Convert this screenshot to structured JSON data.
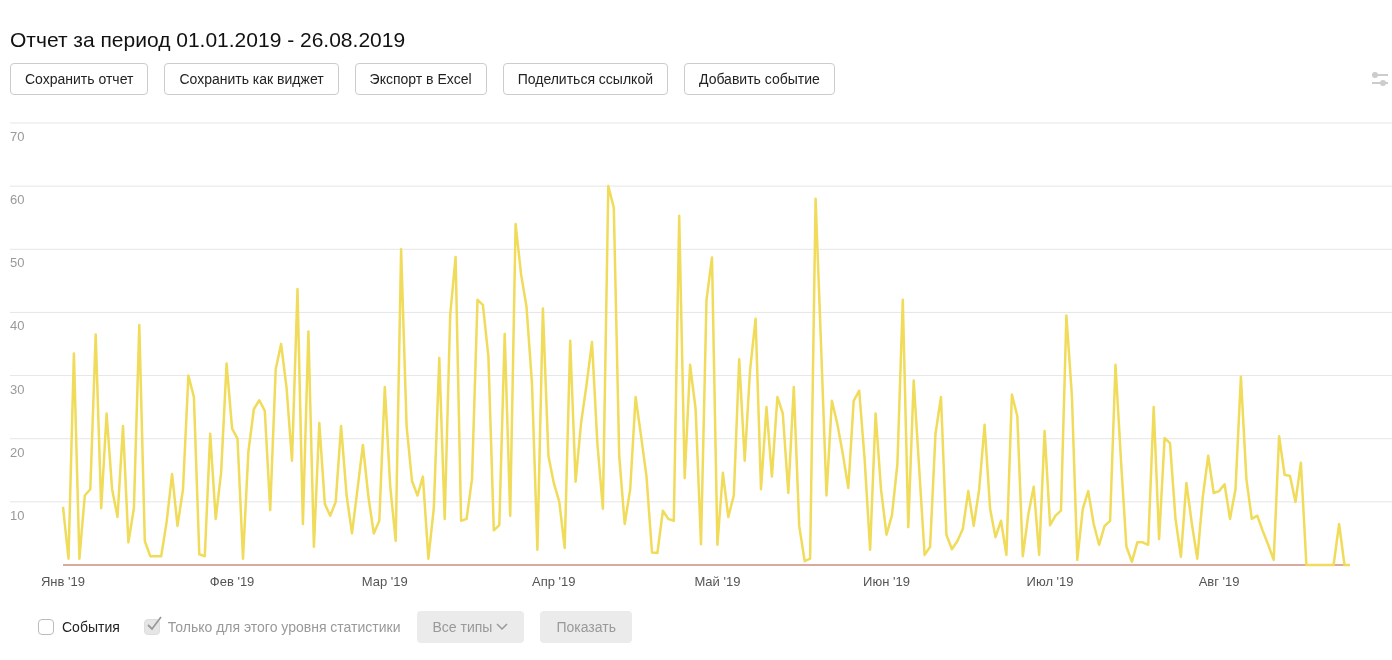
{
  "title": "Отчет за период 01.01.2019 - 26.08.2019",
  "toolbar": [
    "Сохранить отчет",
    "Сохранить как виджет",
    "Экспорт в Excel",
    "Поделиться ссылкой",
    "Добавить событие"
  ],
  "chart": {
    "chart_data": {
      "type": "line",
      "grid": true,
      "ylim": [
        0,
        70
      ],
      "yticks": [
        10,
        20,
        30,
        40,
        50,
        60,
        70
      ],
      "categories": [
        "Янв '19",
        null,
        null,
        null,
        null,
        null,
        null,
        null,
        null,
        null,
        null,
        null,
        null,
        null,
        null,
        null,
        null,
        null,
        null,
        null,
        null,
        null,
        null,
        null,
        null,
        null,
        null,
        null,
        null,
        null,
        null,
        "Фев '19",
        null,
        null,
        null,
        null,
        null,
        null,
        null,
        null,
        null,
        null,
        null,
        null,
        null,
        null,
        null,
        null,
        null,
        null,
        null,
        null,
        null,
        null,
        null,
        null,
        null,
        null,
        null,
        "Мар '19",
        null,
        null,
        null,
        null,
        null,
        null,
        null,
        null,
        null,
        null,
        null,
        null,
        null,
        null,
        null,
        null,
        null,
        null,
        null,
        null,
        null,
        null,
        null,
        null,
        null,
        null,
        null,
        null,
        null,
        null,
        "Апр '19",
        null,
        null,
        null,
        null,
        null,
        null,
        null,
        null,
        null,
        null,
        null,
        null,
        null,
        null,
        null,
        null,
        null,
        null,
        null,
        null,
        null,
        null,
        null,
        null,
        null,
        null,
        null,
        null,
        null,
        "Май '19",
        null,
        null,
        null,
        null,
        null,
        null,
        null,
        null,
        null,
        null,
        null,
        null,
        null,
        null,
        null,
        null,
        null,
        null,
        null,
        null,
        null,
        null,
        null,
        null,
        null,
        null,
        null,
        null,
        null,
        null,
        "Июн '19",
        null,
        null,
        null,
        null,
        null,
        null,
        null,
        null,
        null,
        null,
        null,
        null,
        null,
        null,
        null,
        null,
        null,
        null,
        null,
        null,
        null,
        null,
        null,
        null,
        null,
        null,
        null,
        null,
        null,
        "Июл '19",
        null,
        null,
        null,
        null,
        null,
        null,
        null,
        null,
        null,
        null,
        null,
        null,
        null,
        null,
        null,
        null,
        null,
        null,
        null,
        null,
        null,
        null,
        null,
        null,
        null,
        null,
        null,
        null,
        null,
        null,
        "Авг '19",
        null,
        null,
        null,
        null,
        null,
        null,
        null,
        null,
        null,
        null,
        null,
        null,
        null,
        null,
        null,
        null,
        null,
        null,
        null,
        null,
        null,
        null,
        null,
        null
      ],
      "series": [
        {
          "color": "#f0dc5a",
          "values": [
            9.2,
            1,
            33.5,
            1,
            11,
            12,
            36.5,
            9,
            24,
            12,
            7.6,
            22,
            3.6,
            9,
            38,
            3.8,
            1.4,
            1.4,
            1.4,
            6.8,
            14.4,
            6.2,
            12,
            30,
            26.6,
            1.7,
            1.4,
            20.8,
            7.3,
            14.6,
            31.9,
            21.6,
            20,
            1,
            18,
            24.7,
            26.1,
            24.4,
            8.7,
            31,
            35,
            28,
            16.5,
            43.7,
            6.5,
            37,
            2.9,
            22.5,
            9.7,
            7.8,
            10,
            22,
            11,
            5,
            12,
            19,
            10.8,
            5,
            7,
            28.2,
            12.5,
            3.8,
            50,
            22,
            13.3,
            11,
            14,
            1,
            9,
            32.8,
            7.3,
            39.6,
            48.8,
            7,
            7.3,
            13.6,
            42,
            41.2,
            33,
            5.5,
            6.3,
            36.6,
            7.8,
            54,
            46,
            40.9,
            28.7,
            2.4,
            40.6,
            17.3,
            13,
            10,
            2.7,
            35.5,
            13.2,
            22.5,
            28.5,
            35.3,
            19.2,
            8.9,
            60,
            56.6,
            17.3,
            6.5,
            12,
            26.6,
            20.4,
            14,
            2,
            1.9,
            8.6,
            7.3,
            7,
            55.3,
            13.8,
            31.7,
            24.7,
            3.3,
            42,
            48.7,
            3.2,
            14.6,
            7.6,
            11,
            32.6,
            16.5,
            30.9,
            39,
            12,
            25,
            14,
            26.6,
            24,
            11.4,
            28.2,
            6.2,
            0.6,
            1,
            58,
            35,
            11,
            26,
            22.3,
            17.6,
            12.2,
            26,
            27.6,
            16.8,
            2.4,
            24,
            12,
            4.8,
            7.8,
            16,
            42,
            6,
            29.2,
            15.2,
            1.6,
            2.9,
            20.8,
            26.6,
            4.8,
            2.5,
            3.8,
            5.7,
            11.7,
            6.2,
            12,
            22.2,
            8.9,
            4.4,
            7,
            1.6,
            27,
            23.6,
            1.4,
            8,
            12.4,
            1.6,
            21.2,
            6.3,
            7.8,
            8.6,
            39.5,
            26.8,
            0.8,
            8.9,
            11.7,
            6.5,
            3.2,
            6.2,
            7,
            31.7,
            16.5,
            2.9,
            0.5,
            3.6,
            3.6,
            3.2,
            25,
            4.1,
            20.1,
            19.3,
            7.3,
            1.3,
            13,
            6.5,
            1,
            10.8,
            17.3,
            11.4,
            11.7,
            12.8,
            7.3,
            12,
            29.8,
            13.6,
            7.3,
            7.8,
            5.4,
            3.2,
            0.8,
            20.4,
            14.3,
            14.1,
            10,
            16.2,
            0,
            0,
            0,
            0,
            0,
            0,
            6.5,
            0,
            0
          ]
        }
      ]
    }
  },
  "filters": {
    "events": {
      "label": "События",
      "checked": false
    },
    "level_only": {
      "label": "Только для этого уровня статистики",
      "checked": true,
      "disabled": true
    },
    "types": {
      "label": "Все типы",
      "disabled": true
    },
    "show": {
      "label": "Показать",
      "disabled": true
    }
  }
}
